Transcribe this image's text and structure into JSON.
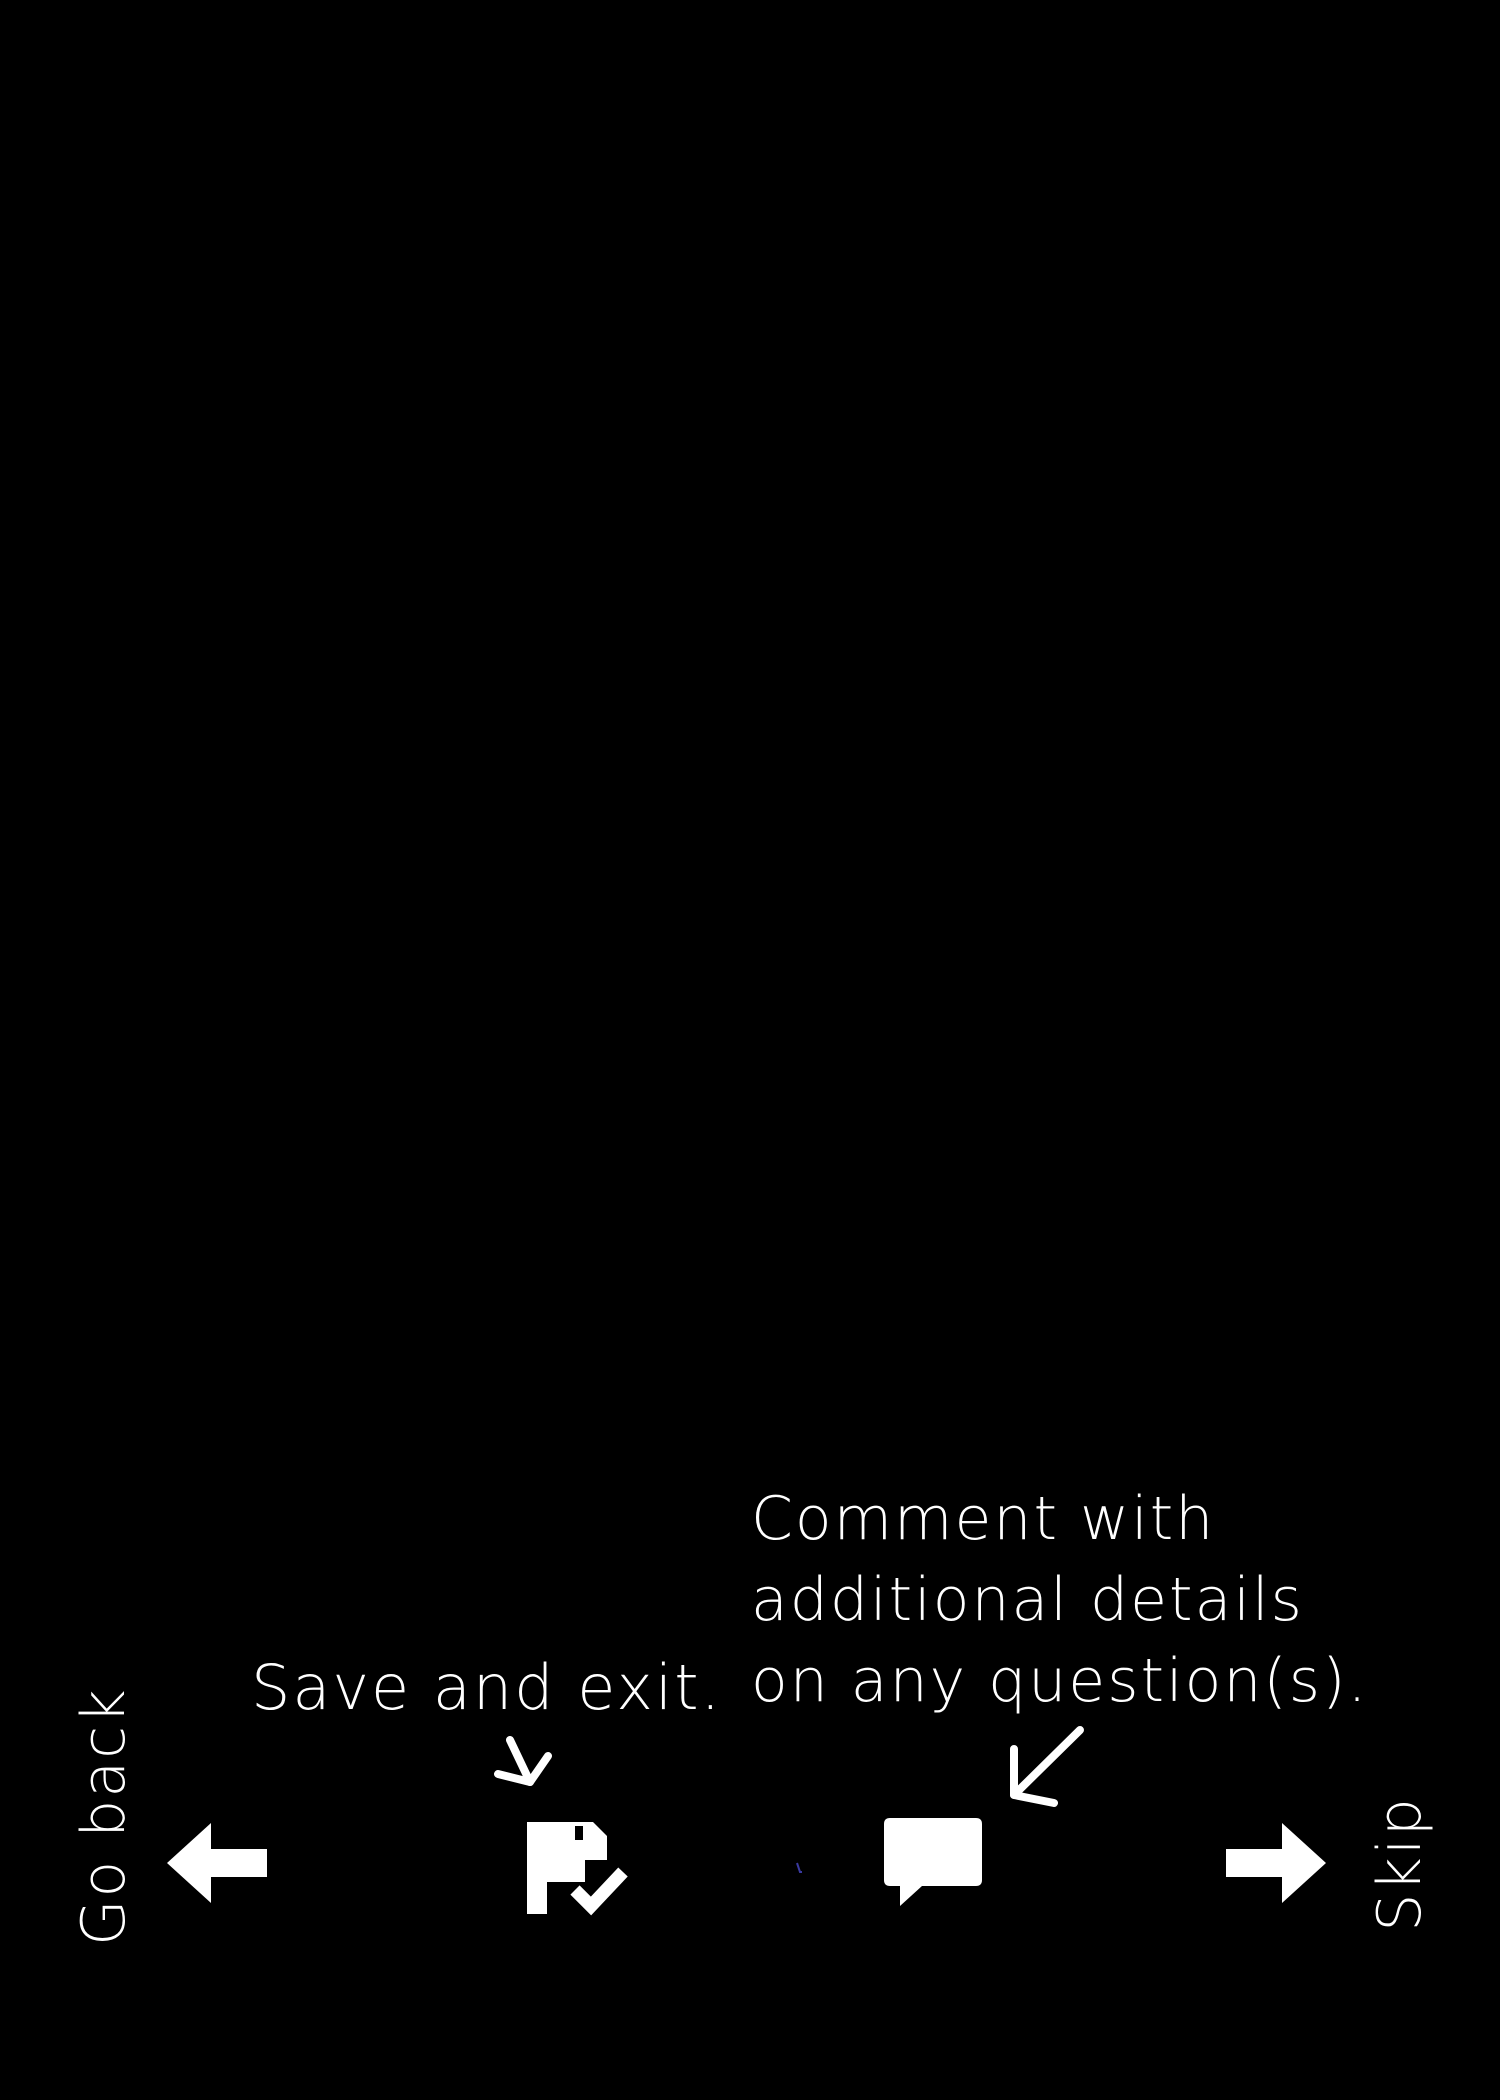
{
  "nav": {
    "back_label": "Go back",
    "skip_label": "Skip"
  },
  "hints": {
    "save": "Save and exit.",
    "comment": "Comment with\nadditional details\non any question(s)."
  },
  "icons": {
    "back": "arrow-left-icon",
    "save": "save-exit-icon",
    "comment": "comment-bubble-icon",
    "skip": "arrow-right-icon",
    "save_pointer": "pointer-arrow-icon",
    "comment_pointer": "pointer-arrow-icon"
  },
  "colors": {
    "background": "#000000",
    "foreground": "#ffffff"
  }
}
